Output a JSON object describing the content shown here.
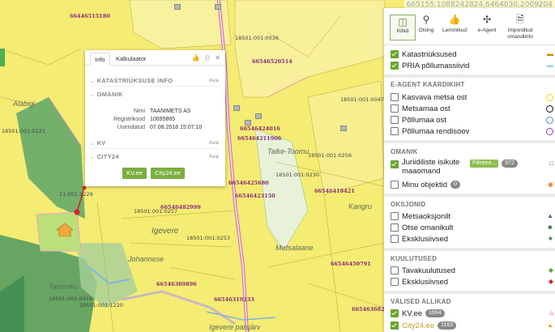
{
  "coords": "665155.1088242824,6464030.2009204",
  "map": {
    "parcel_ids": [
      "66446515180",
      "66546520514",
      "66546424016",
      "665464211906",
      "66546425680",
      "66546423150",
      "66546418421",
      "66546482999",
      "66546450791",
      "66546389896",
      "66546319233",
      "66546368201"
    ],
    "cadastral_labels": [
      "18501:001:0221",
      "18501:001:0036",
      "18501:001:0047",
      "18501:001:0256",
      "18501:001:0230",
      "18501:001:0257",
      "18501:001:0419",
      "18501:001:1220",
      "11:001:1229",
      "18501:001:0253"
    ],
    "places": [
      "Alabigi",
      "Talke-Toomu",
      "Kangru",
      "Igevere",
      "Johannese",
      "Metsalaane",
      "Tammiku",
      "Igevere paisjärv"
    ]
  },
  "popup": {
    "tabs": [
      "Info",
      "Kalkulaator"
    ],
    "icons": [
      "thumbs-up-icon",
      "print-icon",
      "close-icon"
    ],
    "sections": {
      "katastri": "KATASTRIÜKSUSE INFO",
      "omanik": "OMANIK",
      "kv": "KV",
      "city24": "CITY24",
      "ava": "Ava"
    },
    "fields": [
      {
        "key": "Nimi",
        "value": "TAANIMETS AS"
      },
      {
        "key": "Registrikood",
        "value": "10695865"
      },
      {
        "key": "Uuendatud",
        "value": "07.08.2018 15:07:10"
      }
    ],
    "buttons": [
      "KV.ee",
      "City24.ee"
    ]
  },
  "panel": {
    "toolbar": [
      {
        "label": "Kihid",
        "icon": "layers-icon"
      },
      {
        "label": "Otsing",
        "icon": "search-icon"
      },
      {
        "label": "Lemmikud",
        "icon": "thumbs-up-icon"
      },
      {
        "label": "e-Agent",
        "icon": "target-icon"
      },
      {
        "label": "Imporditud omandiinfo",
        "icon": "file-icon"
      }
    ],
    "base_layers": [
      {
        "label": "Katastriüksused",
        "checked": true
      },
      {
        "label": "PRIA põllumassiivid",
        "checked": true
      }
    ],
    "e_agent": {
      "title": "E-AGENT KAARDIKIHT",
      "items": [
        {
          "label": "Kasvava metsa ost",
          "color": "#f5d800"
        },
        {
          "label": "Metsamaa ost",
          "color": "#111111"
        },
        {
          "label": "Põllumaa ost",
          "color": "#4a90d9"
        },
        {
          "label": "Põllumaa rendisoov",
          "color": "#8a3fc0"
        }
      ]
    },
    "omanik": {
      "title": "OMANIK",
      "items": [
        {
          "label": "Juriidiliste isikute maaomand",
          "chip": "Filtreeri...",
          "count": "972",
          "checked": true
        },
        {
          "label": "Minu objektid",
          "count": "0",
          "checked": false
        }
      ]
    },
    "oksjonid": {
      "title": "OKSJONID",
      "items": [
        "Metsaoksjonilt",
        "Otse omanikult",
        "Eksklusiivsed"
      ]
    },
    "kuulutused": {
      "title": "KUULUTUSED",
      "items": [
        "Tavakuulutused",
        "Eksklusiivsed"
      ]
    },
    "allikad": {
      "title": "VÄLISED ALLIKAD",
      "items": [
        {
          "label": "KV.ee",
          "count": "1694"
        },
        {
          "label": "City24.ee",
          "count": "1163"
        }
      ]
    }
  }
}
